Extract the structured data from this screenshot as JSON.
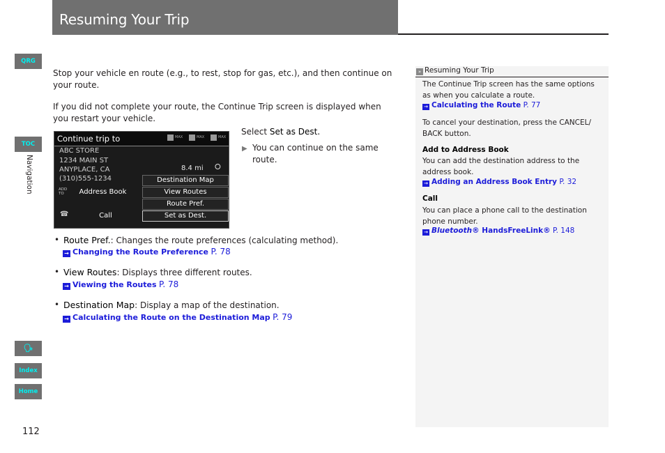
{
  "header": {
    "title": "Resuming Your Trip"
  },
  "side_tabs": {
    "qrg": "QRG",
    "toc": "TOC",
    "section": "Navigation",
    "voice_icon": "voice-command-icon",
    "index": "Index",
    "home": "Home"
  },
  "page_number": "112",
  "main": {
    "paragraph1": "Stop your vehicle en route (e.g., to rest, stop for gas, etc.), and then continue on your route.",
    "paragraph2": "If you did not complete your route, the Continue Trip screen is displayed when you restart your vehicle.",
    "select_prefix": "Select ",
    "select_target": "Set as Dest.",
    "note": "You can continue on the same route.",
    "bullets": [
      {
        "term": "Route Pref.",
        "desc": ": Changes the route preferences (calculating method).",
        "link": "Changing the Route Preference",
        "page": "P. 78"
      },
      {
        "term": "View Routes",
        "desc": ": Displays three different routes.",
        "link": "Viewing the Routes",
        "page": "P. 78"
      },
      {
        "term": "Destination Map",
        "desc": ": Display a map of the destination.",
        "link": "Calculating the Route on the Destination Map",
        "page": "P. 79"
      }
    ]
  },
  "screen": {
    "title": "Continue trip to",
    "max_label": "MAX",
    "address": [
      "ABC STORE",
      "1234 MAIN ST",
      "ANYPLACE, CA",
      "(310)555-1234"
    ],
    "distance": "8.4 mi",
    "add_to_label": "ADD TO",
    "buttons": {
      "destination_map": "Destination Map",
      "address_book": "Address Book",
      "view_routes": "View Routes",
      "route_pref": "Route Pref.",
      "call": "Call",
      "set_as_dest": "Set as Dest."
    }
  },
  "sidebar": {
    "heading": "Resuming Your Trip",
    "p1": "The Continue Trip screen has the same options as when you calculate a route.",
    "link1": {
      "text": "Calculating the Route",
      "page": "P. 77"
    },
    "p2": "To cancel your destination, press the CANCEL/ BACK button.",
    "h_address": "Add to Address Book",
    "p3": "You can add the destination address to the address book.",
    "link2": {
      "text": "Adding an Address Book Entry",
      "page": "P. 32"
    },
    "h_call": "Call",
    "p4": "You can place a phone call to the destination phone number.",
    "link3": {
      "italic": "Bluetooth",
      "text": "® HandsFreeLink®",
      "page": "P. 148"
    }
  }
}
